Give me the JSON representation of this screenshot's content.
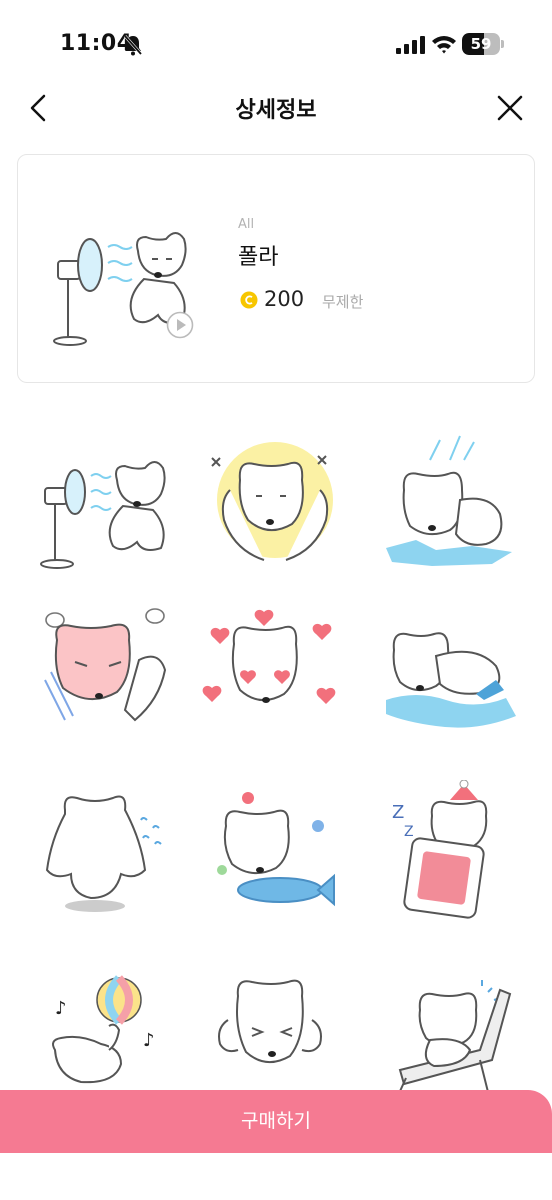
{
  "status": {
    "time": "11:04",
    "battery_level": "59",
    "icons": [
      "bell-slash-icon",
      "signal-icon",
      "wifi-icon",
      "battery-icon"
    ]
  },
  "nav": {
    "title": "상세정보",
    "back_icon": "chevron-left-icon",
    "close_icon": "close-icon"
  },
  "item": {
    "category": "All",
    "name": "폴라",
    "price": "200",
    "duration": "무제한",
    "coin_color": "#f7c600"
  },
  "stickers": [
    {
      "name": "bear-with-fan"
    },
    {
      "name": "bear-cheering"
    },
    {
      "name": "bear-slipping-ice"
    },
    {
      "name": "bear-angry"
    },
    {
      "name": "bear-hearts"
    },
    {
      "name": "bear-swimming"
    },
    {
      "name": "bear-back-view"
    },
    {
      "name": "bear-with-fish"
    },
    {
      "name": "bear-sleeping"
    },
    {
      "name": "bear-beach-ball"
    },
    {
      "name": "bear-covering-ears"
    },
    {
      "name": "bear-sunbathing"
    }
  ],
  "buy_button": {
    "label": "구매하기",
    "color": "#f57a92"
  }
}
